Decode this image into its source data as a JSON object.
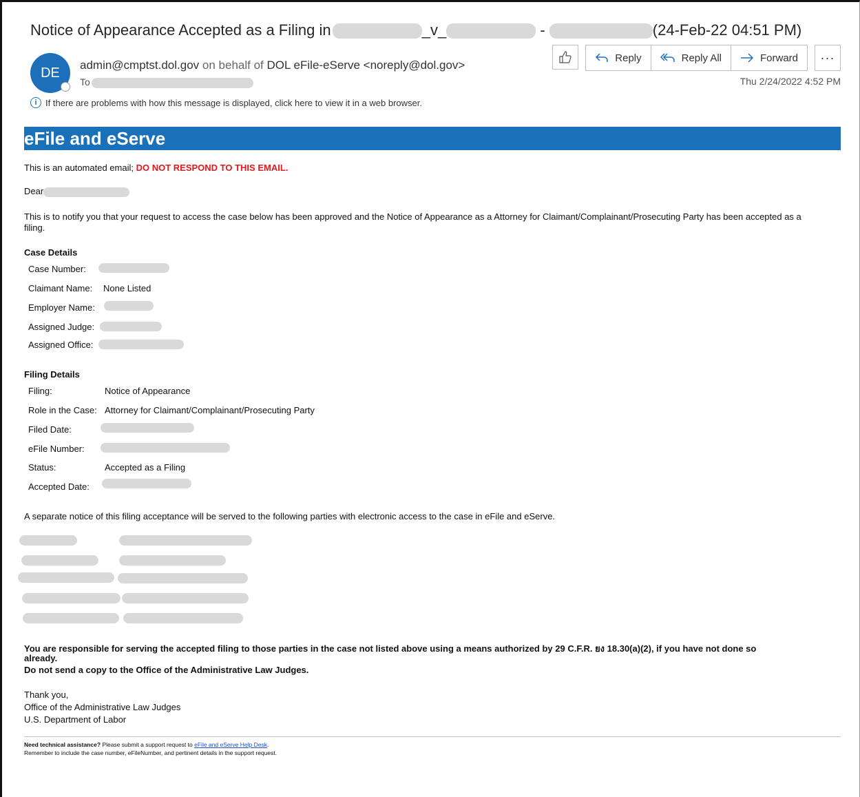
{
  "header": {
    "subject_prefix": "Notice of Appearance Accepted as a Filing in",
    "subject_mid1": "_v_",
    "subject_mid2": "-",
    "subject_suffix": "(24-Feb-22 04:51 PM)",
    "avatar_initials": "DE",
    "sender_address": "admin@cmptst.dol.gov",
    "on_behalf_text": "on behalf of",
    "sender_name": "DOL eFile-eServe <noreply@dol.gov>",
    "to_label": "To",
    "date": "Thu 2/24/2022 4:52 PM",
    "info_text": "If there are problems with how this message is displayed, click here to view it in a web browser."
  },
  "toolbar": {
    "reply_label": "Reply",
    "reply_all_label": "Reply All",
    "forward_label": "Forward",
    "more_label": "···"
  },
  "icons": {
    "like": "thumbs-up-icon",
    "reply": "reply-arrow-icon",
    "reply_all": "reply-all-arrow-icon",
    "forward": "forward-arrow-icon",
    "info": "info-icon"
  },
  "colors": {
    "banner": "#1a70b9",
    "avatar": "#1c6fb8",
    "warning": "#e0191b",
    "accent": "#1e6fc1"
  },
  "body": {
    "banner_title": "eFile and eServe",
    "automated_text": "This is an automated email;",
    "do_not_respond": "DO NOT RESPOND TO THIS EMAIL.",
    "dear": "Dear",
    "notify_line1": "This is to notify you that your request to access the case below has been approved and the Notice of Appearance as a Attorney for Claimant/Complainant/Prosecuting Party has been accepted as a",
    "notify_line2": "filing.",
    "case_details_heading": "Case Details",
    "case_number_label": "Case Number:",
    "claimant_name_label": "Claimant Name:",
    "claimant_name_value": "None Listed",
    "employer_name_label": "Employer Name:",
    "assigned_judge_label": "Assigned Judge:",
    "assigned_office_label": "Assigned Office:",
    "filing_details_heading": "Filing Details",
    "filing_label": "Filing:",
    "filing_value": "Notice of Appearance",
    "role_label": "Role in the Case:",
    "role_value": "Attorney for Claimant/Complainant/Prosecuting Party",
    "filed_date_label": "Filed Date:",
    "efile_number_label": "eFile Number:",
    "status_label": "Status:",
    "status_value": "Accepted as a Filing",
    "accepted_date_label": "Accepted Date:",
    "separate_notice": "A separate notice of this filing acceptance will be served to the following parties with electronic access to the case in eFile and eServe.",
    "responsible_line1": "You are responsible for serving the accepted filing to those parties in the case not listed above using a means authorized by 29 C.F.R. ยง 18.30(a)(2), if you have not done so",
    "responsible_line2": "already.",
    "do_not_send": "Do not send a copy to the Office of the Administrative Law Judges.",
    "thank_you": "Thank you,",
    "office": "Office of the Administrative Law Judges",
    "department": "U.S. Department of Labor"
  },
  "footer": {
    "need_help": "Need technical assistance?",
    "submit_text": "Please submit a support request to",
    "help_desk_link": "eFile and eServe Help Desk",
    "period": ".",
    "remember_text": "Remember to include the case number, eFileNumber, and pertinent details in the support request."
  }
}
